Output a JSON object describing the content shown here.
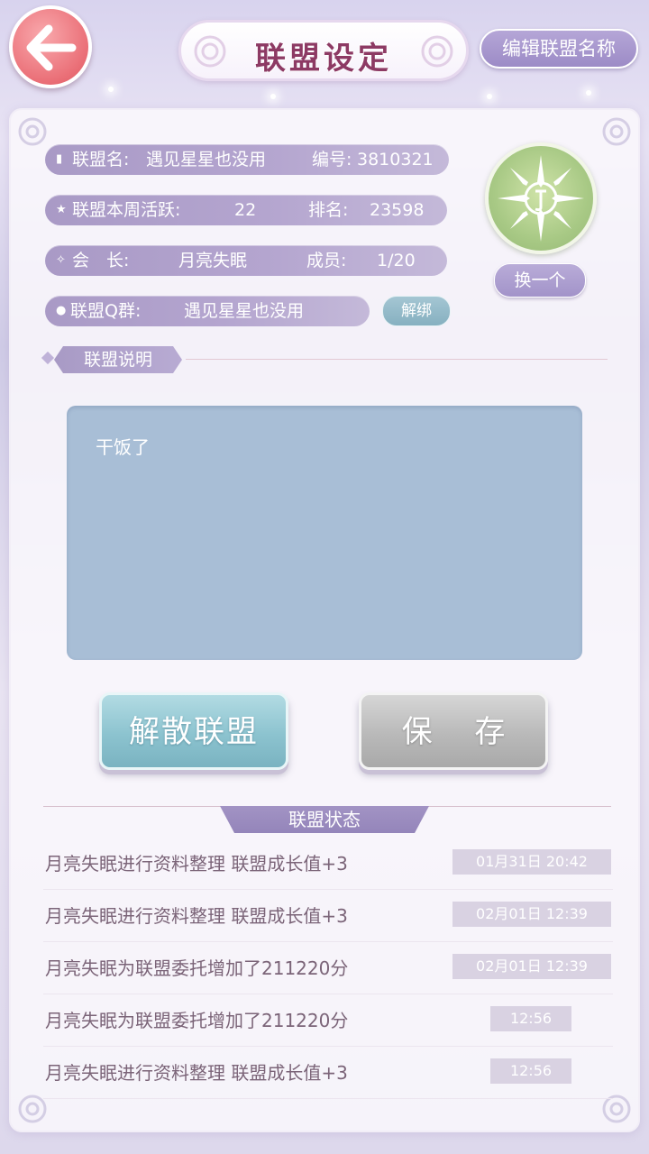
{
  "header": {
    "title": "联盟设定",
    "edit_name_label": "编辑联盟名称"
  },
  "info": {
    "name_label": "联盟名:",
    "name_value": "遇见星星也没用",
    "id_label": "编号:",
    "id_value": "3810321",
    "activity_label": "联盟本周活跃:",
    "activity_value": "22",
    "rank_label": "排名:",
    "rank_value": "23598",
    "leader_label": "会　长:",
    "leader_value": "月亮失眠",
    "members_label": "成员:",
    "members_value": "1/20",
    "qgroup_label": "联盟Q群:",
    "qgroup_value": "遇见星星也没用",
    "unbind_label": "解绑",
    "swap_label": "换一个"
  },
  "description": {
    "section_label": "联盟说明",
    "text": "干饭了"
  },
  "actions": {
    "disband_label": "解散联盟",
    "save_label": "保 存"
  },
  "status": {
    "section_label": "联盟状态",
    "entries": [
      {
        "text": "月亮失眠进行资料整理 联盟成长值+3",
        "time": "01月31日 20:42"
      },
      {
        "text": "月亮失眠进行资料整理 联盟成长值+3",
        "time": "02月01日 12:39"
      },
      {
        "text": "月亮失眠为联盟委托增加了211220分",
        "time": "02月01日 12:39"
      },
      {
        "text": "月亮失眠为联盟委托增加了211220分",
        "time": "12:56"
      },
      {
        "text": "月亮失眠进行资料整理 联盟成长值+3",
        "time": "12:56"
      }
    ]
  },
  "icons": {
    "back": "back-arrow-icon",
    "emblem": "alliance-emblem-icon"
  },
  "colors": {
    "title": "#8d3a64",
    "pill": "#a99ac6",
    "disband": "#8cc3cf",
    "save": "#b9b9b9",
    "description_bg": "#a8bed6",
    "back_button": "#ea6e76",
    "emblem": "#a8c985"
  }
}
